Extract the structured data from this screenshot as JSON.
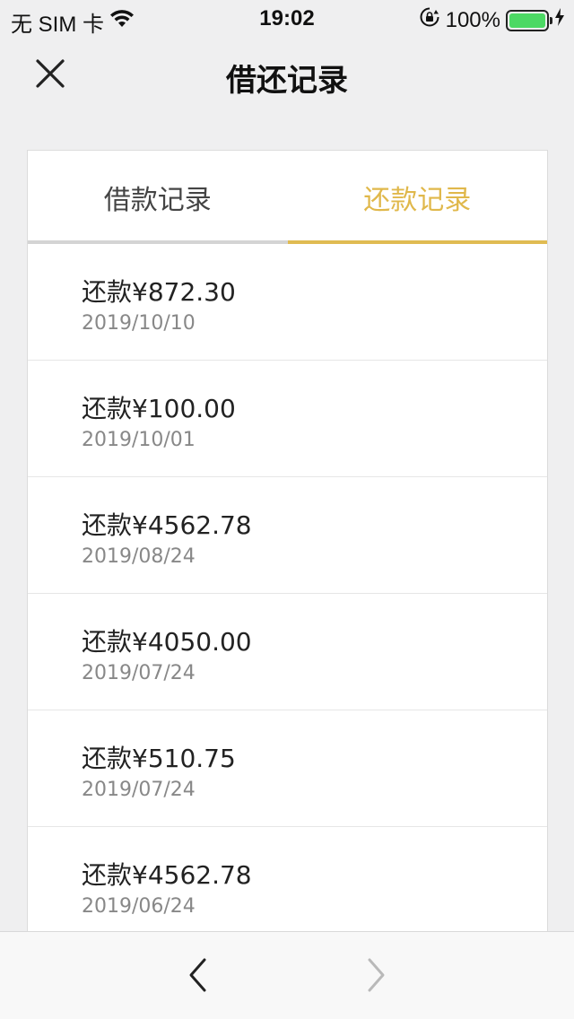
{
  "status_bar": {
    "carrier": "无 SIM 卡",
    "time": "19:02",
    "battery": "100%",
    "battery_level": 1.0
  },
  "nav": {
    "title": "借还记录",
    "close_icon": "close-icon"
  },
  "tabs": [
    {
      "label": "借款记录",
      "active": false
    },
    {
      "label": "还款记录",
      "active": true
    }
  ],
  "records": [
    {
      "amount": "还款¥872.30",
      "date": "2019/10/10"
    },
    {
      "amount": "还款¥100.00",
      "date": "2019/10/01"
    },
    {
      "amount": "还款¥4562.78",
      "date": "2019/08/24"
    },
    {
      "amount": "还款¥4050.00",
      "date": "2019/07/24"
    },
    {
      "amount": "还款¥510.75",
      "date": "2019/07/24"
    },
    {
      "amount": "还款¥4562.78",
      "date": "2019/06/24"
    },
    {
      "amount": "",
      "date": ""
    }
  ],
  "toolbar": {
    "back_icon": "chevron-left-icon",
    "forward_icon": "chevron-right-icon"
  },
  "colors": {
    "accent": "#e0b84b",
    "battery_green": "#4cd964",
    "background": "#efeff0"
  }
}
